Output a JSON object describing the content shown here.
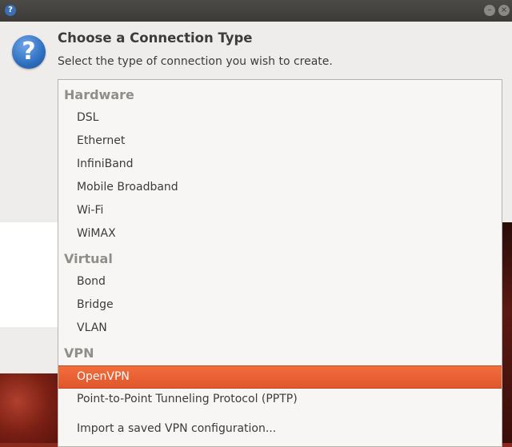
{
  "window": {
    "titlebar_icon": "?",
    "minimize_icon": "–",
    "close_icon": "×"
  },
  "dialog": {
    "icon": "?",
    "title": "Choose a Connection Type",
    "subtitle": "Select the type of connection you wish to create."
  },
  "menu": {
    "groups": [
      {
        "header": "Hardware",
        "items": [
          "DSL",
          "Ethernet",
          "InfiniBand",
          "Mobile Broadband",
          "Wi-Fi",
          "WiMAX"
        ]
      },
      {
        "header": "Virtual",
        "items": [
          "Bond",
          "Bridge",
          "VLAN"
        ]
      },
      {
        "header": "VPN",
        "items": [
          "OpenVPN",
          "Point-to-Point Tunneling Protocol (PPTP)"
        ]
      }
    ],
    "selected": "OpenVPN",
    "import_label": "Import a saved VPN configuration..."
  },
  "colors": {
    "selection": "#e95420",
    "header": "#8e8e8a",
    "text": "#3c3c3c"
  }
}
